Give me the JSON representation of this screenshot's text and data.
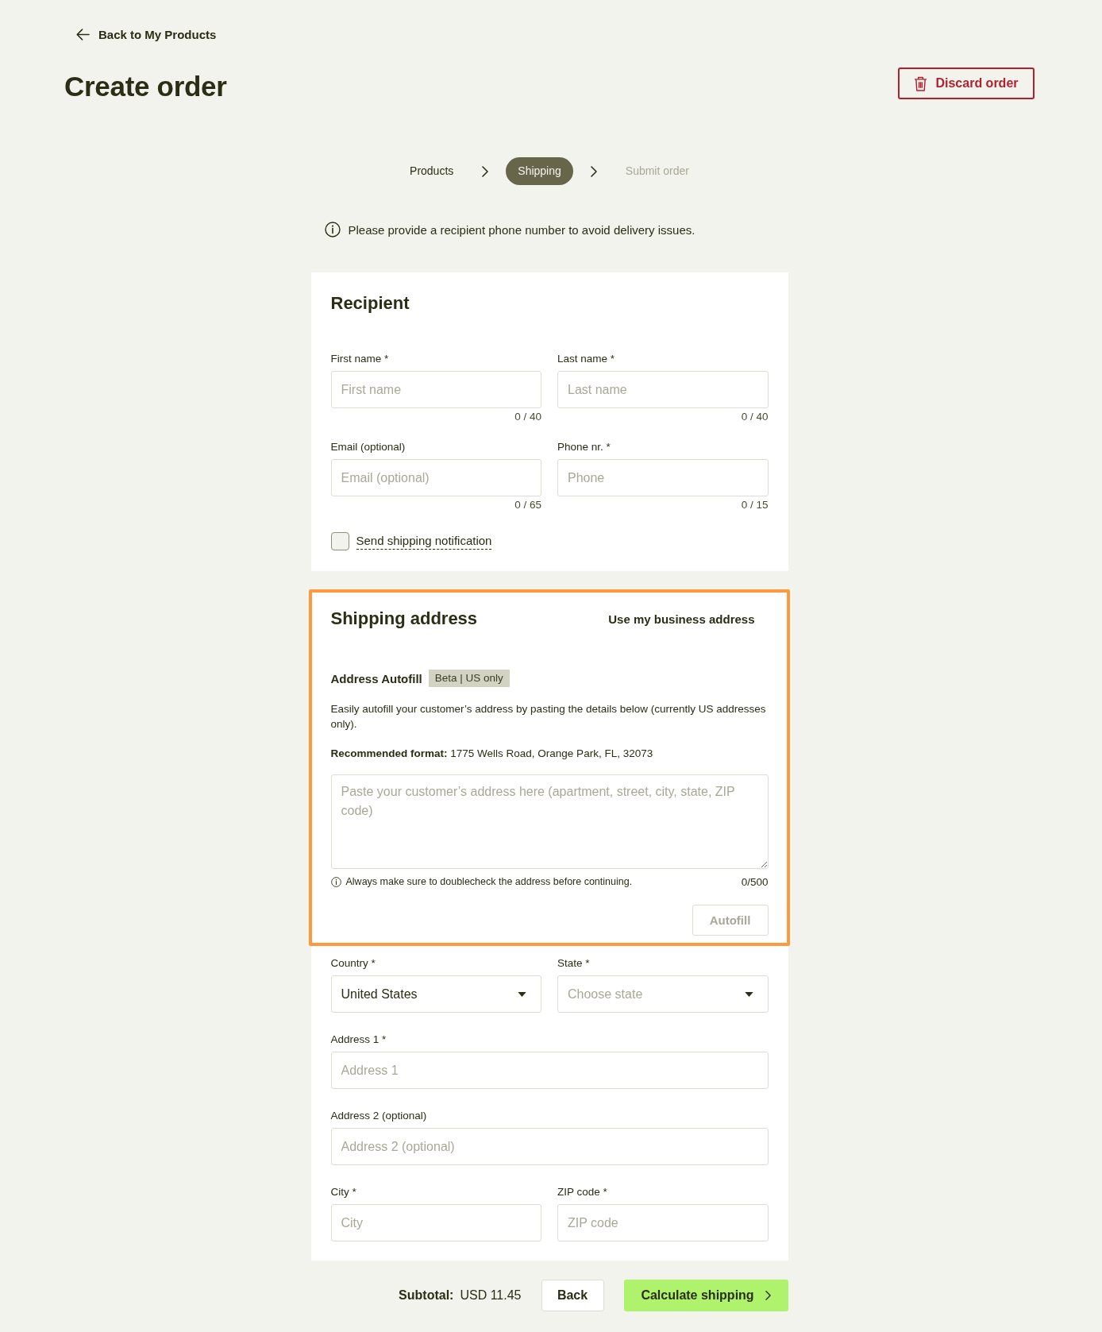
{
  "back_link": {
    "label": "Back to My Products"
  },
  "page_title": "Create order",
  "discard_button": {
    "label": "Discard order"
  },
  "stepper": [
    {
      "label": "Products",
      "selected": false,
      "disabled": false
    },
    {
      "label": "Shipping",
      "selected": true,
      "disabled": false
    },
    {
      "label": "Submit order",
      "selected": false,
      "disabled": true
    }
  ],
  "notice": {
    "text": "Please provide a recipient phone number to avoid delivery issues."
  },
  "recipient": {
    "title": "Recipient",
    "rows": [
      {
        "fields": [
          {
            "label": "First name *",
            "placeholder": "First name",
            "counter": "0 / 40"
          },
          {
            "label": "Last name *",
            "placeholder": "Last name",
            "counter": "0 / 40"
          }
        ]
      },
      {
        "fields": [
          {
            "label": "Email (optional)",
            "placeholder": "Email (optional)",
            "counter": "0 / 65"
          },
          {
            "label": "Phone nr. *",
            "placeholder": "Phone",
            "counter": "0 / 15"
          }
        ]
      }
    ],
    "notification": {
      "label": "Send shipping notification",
      "checked": false
    }
  },
  "shipping": {
    "title": "Shipping address",
    "highlighted": true,
    "business_link": "Use my business address",
    "autofill": {
      "title": "Address Autofill",
      "badge": "Beta | US only",
      "description": "Easily autofill your customer’s address by pasting the details below (currently US addresses only).",
      "format": "**Recommended format:** 1775 Wells Road, Orange Park, FL, 32073",
      "placeholder": "Paste your customer’s address here (apartment, street, city, state, ZIP code)",
      "hint": "Always make sure to doublecheck the address before continuing.",
      "counter": "0/500",
      "button": {
        "label": "Autofill",
        "disabled": true
      }
    },
    "rows": [
      {
        "fields": [
          {
            "kind": "select",
            "label": "Country *",
            "value": "United States"
          },
          {
            "kind": "select",
            "label": "State *",
            "placeholder": "Choose state"
          }
        ]
      },
      {
        "fields": [
          {
            "kind": "input",
            "label": "Address 1 *",
            "placeholder": "Address 1"
          }
        ]
      },
      {
        "fields": [
          {
            "kind": "input",
            "label": "Address 2 (optional)",
            "placeholder": "Address 2 (optional)"
          }
        ]
      },
      {
        "fields": [
          {
            "kind": "input",
            "label": "City *",
            "placeholder": "City"
          },
          {
            "kind": "input",
            "label": "ZIP code *",
            "placeholder": "ZIP code"
          }
        ]
      }
    ]
  },
  "footer": {
    "subtotal_label": "Subtotal:",
    "subtotal_value": "USD 11.45",
    "back_button": "Back",
    "next_button": "Calculate shipping"
  }
}
